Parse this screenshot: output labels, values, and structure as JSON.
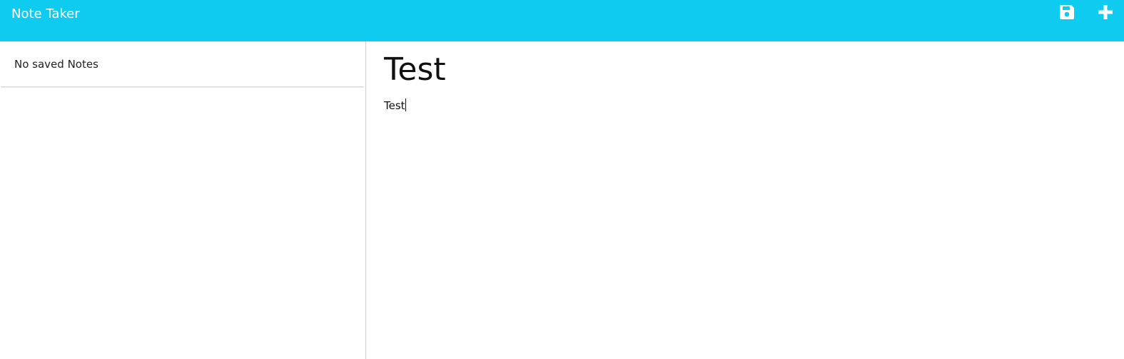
{
  "navbar": {
    "brand": "Note Taker",
    "bg_color": "#0fcbf0",
    "icons": {
      "save": "save-icon",
      "new_note": "plus-icon"
    }
  },
  "sidebar": {
    "empty_message": "No saved Notes"
  },
  "editor": {
    "title_value": "Test",
    "text_value": "Test"
  }
}
